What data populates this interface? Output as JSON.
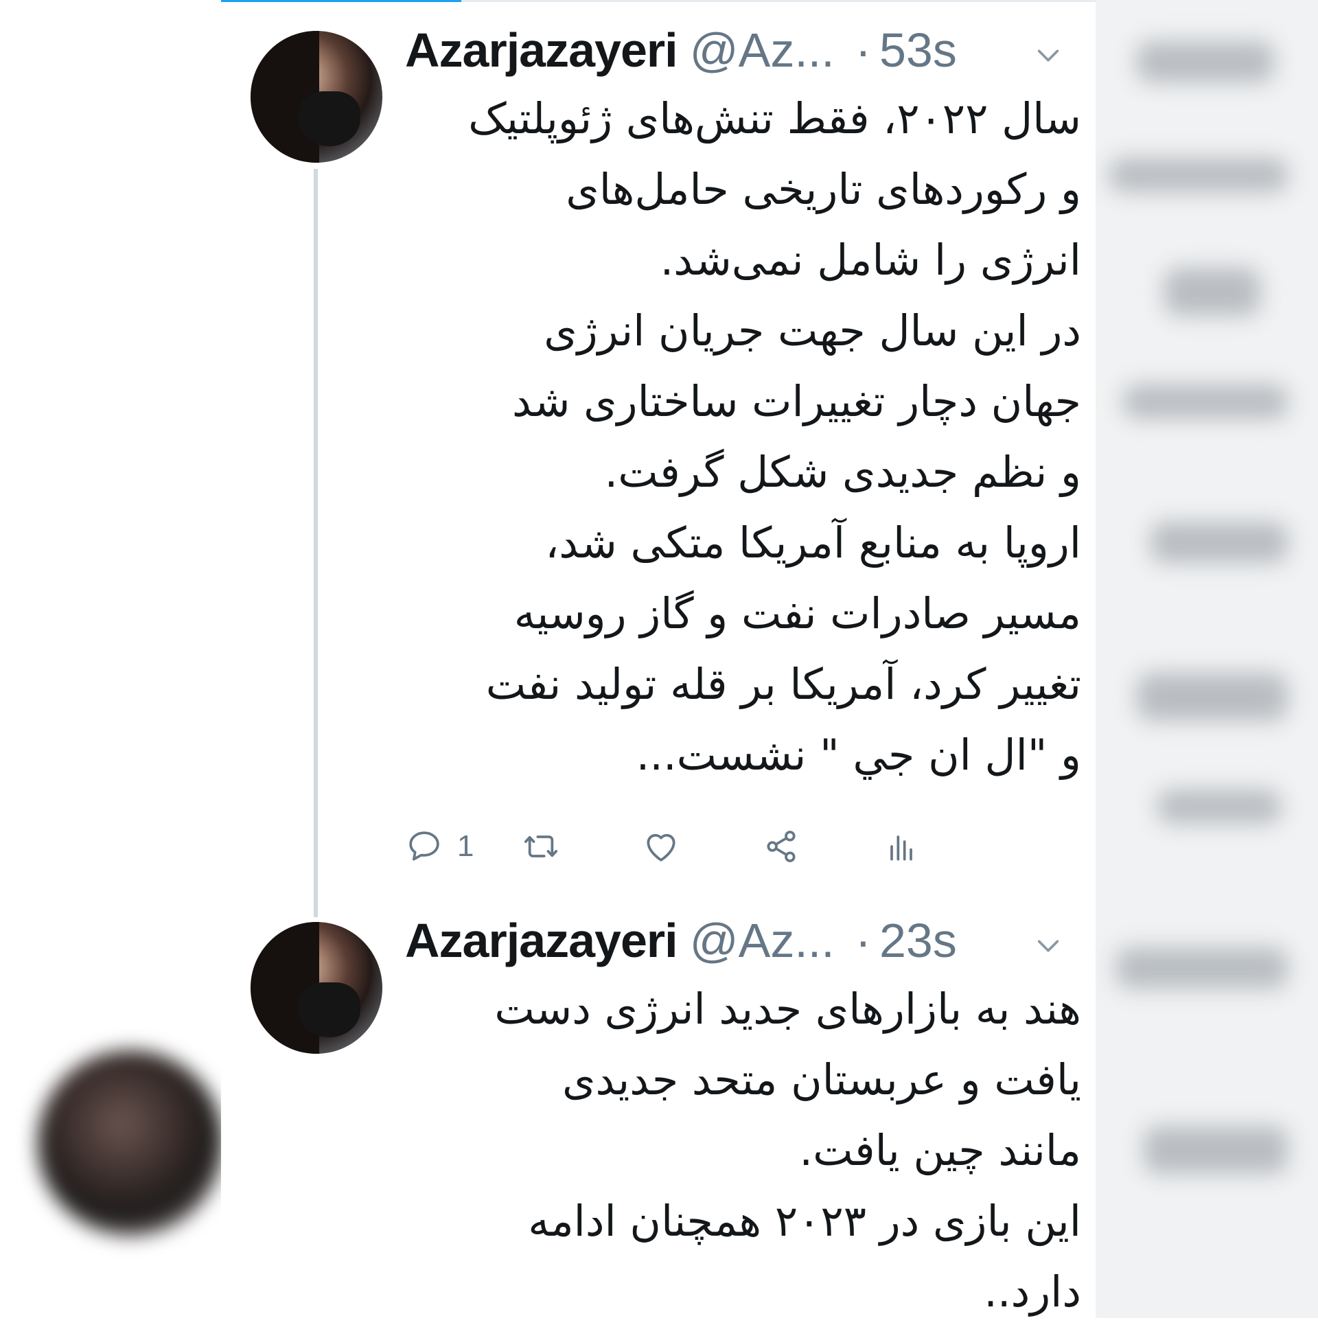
{
  "tweets": [
    {
      "display_name": "Azarjazayeri",
      "handle": "@Az...",
      "separator": "·",
      "time": "53s",
      "lines": [
        "سال ۲۰۲۲، فقط تنش‌های ژئوپلتیک",
        "و رکوردهای تاریخی حامل‌های",
        "انرژی را شامل نمی‌شد.",
        "در این سال جهت جریان انرژی",
        "جهان دچار تغییرات ساختاری شد",
        "و نظم جدیدی شکل گرفت.",
        "اروپا به منابع آمریکا متکی شد،",
        "مسیر  صادرات نفت و گاز روسیه",
        "تغییر کرد، آمریکا بر قله تولید نفت",
        "و \"ال ان جي \" نشست..."
      ],
      "reply_count": "1"
    },
    {
      "display_name": "Azarjazayeri",
      "handle": "@Az...",
      "separator": "·",
      "time": "23s",
      "lines": [
        "هند به بازارهای جدید انرژی دست",
        "یافت و عربستان متحد جدیدی",
        "مانند چین یافت.",
        "این بازی در ۲۰۲۳  همچنان ادامه",
        "دارد.."
      ]
    }
  ],
  "colors": {
    "text": "#14171a",
    "secondary": "#657786",
    "accent": "#1da1f2",
    "thread_line": "#cfd9de"
  },
  "icons": [
    "reply-icon",
    "retweet-icon",
    "like-icon",
    "share-icon",
    "analytics-icon",
    "chevron-down-icon"
  ]
}
